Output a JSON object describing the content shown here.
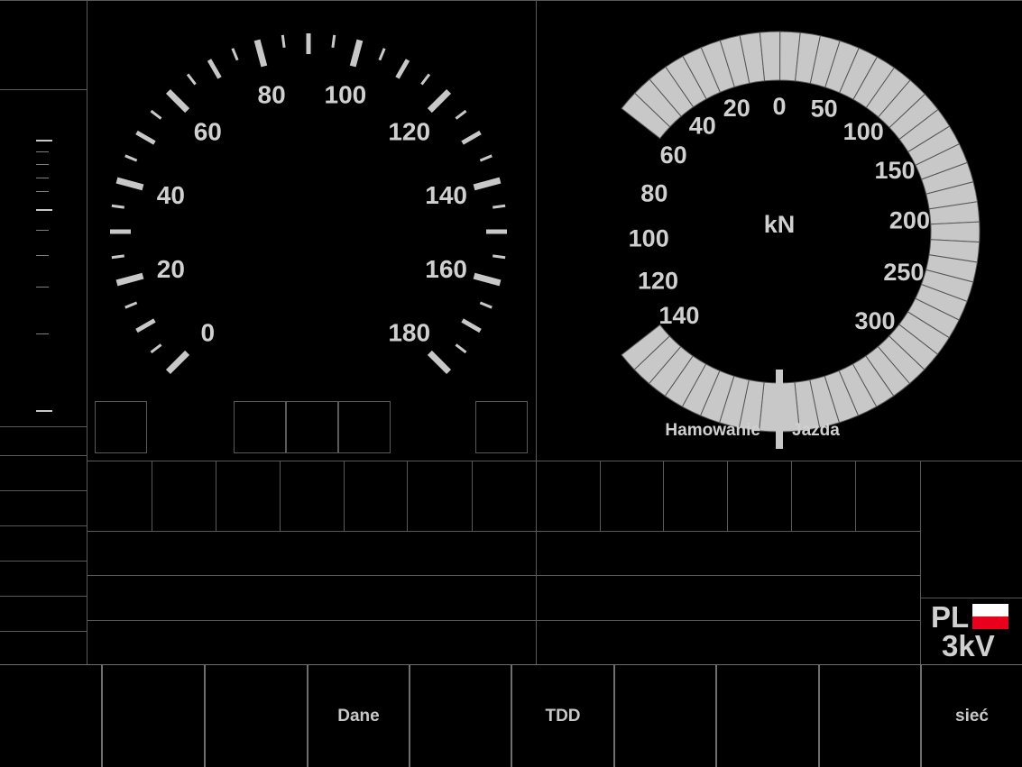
{
  "speedometer": {
    "labels": [
      "0",
      "20",
      "40",
      "60",
      "80",
      "100",
      "120",
      "140",
      "160",
      "180"
    ],
    "max": 180,
    "unit": ""
  },
  "force_gauge": {
    "unit": "kN",
    "braking_labels": [
      "0",
      "20",
      "40",
      "60",
      "80",
      "100",
      "120",
      "140"
    ],
    "traction_labels": [
      "50",
      "100",
      "150",
      "200",
      "250",
      "300"
    ],
    "braking_label": "Hamowanie",
    "traction_label": "Jazda",
    "arc_color": "#c8c8c8"
  },
  "status": {
    "country": "PL",
    "voltage": "3kV",
    "flag_colors": [
      "#ffffff",
      "#e8001c"
    ]
  },
  "buttons": {
    "b1": "",
    "b2": "",
    "b3": "",
    "b4": "Dane",
    "b5": "",
    "b6": "TDD",
    "b7": "",
    "b8": "",
    "b9": "",
    "b10": "sieć"
  }
}
